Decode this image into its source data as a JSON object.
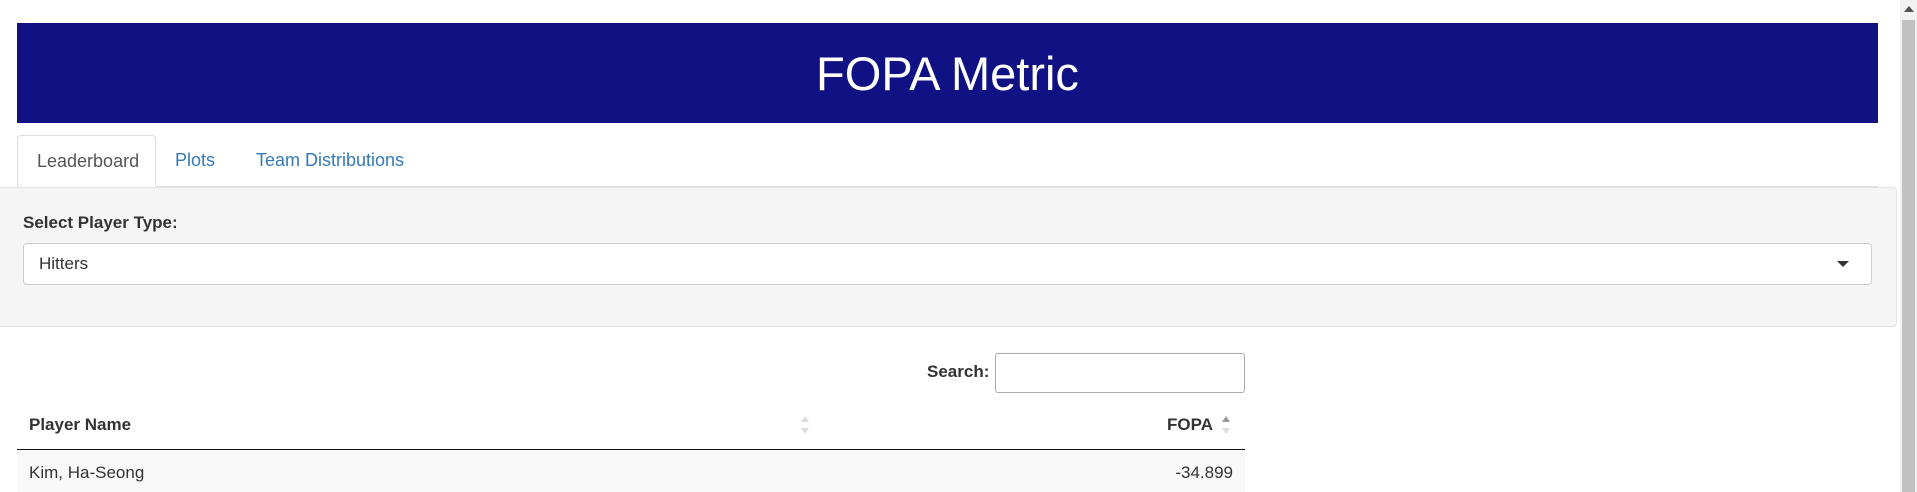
{
  "header": {
    "title": "FOPA Metric",
    "background_color": "#101183"
  },
  "tabs": [
    {
      "label": "Leaderboard",
      "active": true
    },
    {
      "label": "Plots",
      "active": false
    },
    {
      "label": "Team Distributions",
      "active": false
    }
  ],
  "controls": {
    "player_type_label": "Select Player Type:",
    "player_type_value": "Hitters"
  },
  "search": {
    "label": "Search:",
    "value": ""
  },
  "table": {
    "columns": [
      "Player Name",
      "FOPA"
    ],
    "rows": [
      {
        "player_name": "Kim, Ha-Seong",
        "fopa": "-34.899"
      }
    ]
  },
  "colors": {
    "link": "#337ab7",
    "text": "#333333"
  }
}
